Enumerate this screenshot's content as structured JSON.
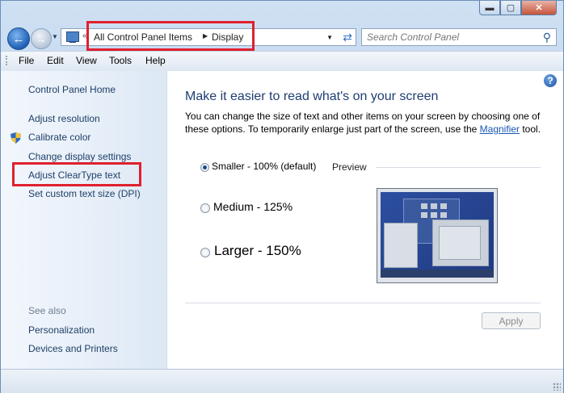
{
  "window": {
    "caption_buttons": {
      "minimize": "▬",
      "maximize": "▢",
      "close": "✕"
    }
  },
  "nav": {
    "back_icon": "back-arrow-icon",
    "forward_icon": "forward-arrow-icon",
    "breadcrumb": [
      "All Control Panel Items",
      "Display"
    ],
    "search_placeholder": "Search Control Panel"
  },
  "menu": {
    "items": [
      "File",
      "Edit",
      "View",
      "Tools",
      "Help"
    ]
  },
  "sidebar": {
    "home": "Control Panel Home",
    "tasks": [
      "Adjust resolution",
      "Calibrate color",
      "Change display settings",
      "Adjust ClearType text",
      "Set custom text size (DPI)"
    ],
    "see_also_title": "See also",
    "see_also": [
      "Personalization",
      "Devices and Printers"
    ]
  },
  "main": {
    "heading": "Make it easier to read what's on your screen",
    "description_before": "You can change the size of text and other items on your screen by choosing one of these options. To temporarily enlarge just part of the screen, use the ",
    "description_link": "Magnifier",
    "description_after": " tool.",
    "options": [
      {
        "label": "Smaller - 100% (default)",
        "checked": true
      },
      {
        "label": "Medium - 125%",
        "checked": false
      },
      {
        "label": "Larger - 150%",
        "checked": false
      }
    ],
    "preview_label": "Preview",
    "apply_label": "Apply"
  },
  "colors": {
    "highlight": "#e0202e",
    "link": "#1e3f66",
    "heading": "#1e3e72"
  }
}
